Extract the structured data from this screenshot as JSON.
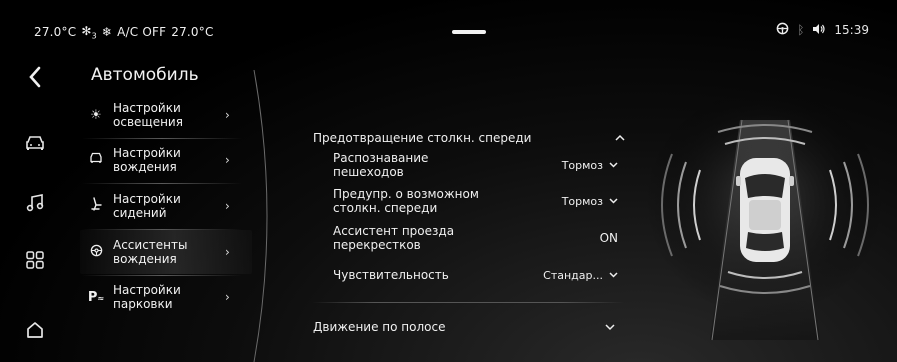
{
  "status_bar": {
    "temp_left": "27.0°C",
    "fan_level": "3",
    "ac_status": "A/C OFF",
    "temp_right": "27.0°C",
    "time": "15:39"
  },
  "header": {
    "title": "Автомобиль"
  },
  "categories": [
    {
      "label": "Настройки\nосвещения",
      "icon": "light-icon"
    },
    {
      "label": "Настройки\nвождения",
      "icon": "steering-icon"
    },
    {
      "label": "Настройки\nсидений",
      "icon": "seat-icon"
    },
    {
      "label": "Ассистенты\nвождения",
      "icon": "assist-icon"
    },
    {
      "label": "Настройки\nпарковки",
      "icon": "parking-icon"
    }
  ],
  "active_category_index": 3,
  "sections": {
    "front_collision": {
      "title": "Предотвращение столкн. спереди",
      "expanded": true,
      "rows": [
        {
          "label": "Распознавание\nпешеходов",
          "value": "Тормоз"
        },
        {
          "label": "Предупр. о возможном\nстолкн. спереди",
          "value": "Тормоз"
        },
        {
          "label": "Ассистент проезда\nперекрестков",
          "value": "ON"
        },
        {
          "label": "Чувствительность",
          "value": "Стандар..."
        }
      ]
    },
    "lane": {
      "title": "Движение по полосе",
      "expanded": false
    }
  }
}
